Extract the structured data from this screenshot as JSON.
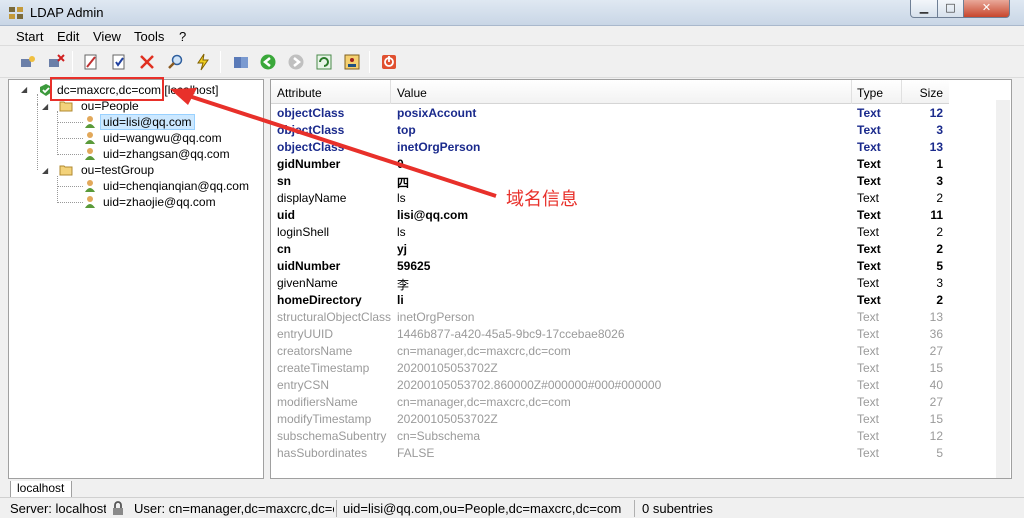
{
  "window": {
    "title": "LDAP Admin",
    "min": "▁",
    "max": "□",
    "close": "✕"
  },
  "menu": [
    "Start",
    "Edit",
    "View",
    "Tools",
    "?"
  ],
  "tree": {
    "root": "dc=maxcrc,dc=com [localhost]",
    "ou_people": "ou=People",
    "people": [
      "uid=lisi@qq.com",
      "uid=wangwu@qq.com",
      "uid=zhangsan@qq.com"
    ],
    "ou_testgroup": "ou=testGroup",
    "testgroup": [
      "uid=chenqianqian@qq.com",
      "uid=zhaojie@qq.com"
    ]
  },
  "table": {
    "headers": {
      "attribute": "Attribute",
      "value": "Value",
      "type": "Type",
      "size": "Size"
    },
    "rows": [
      {
        "attr": "objectClass",
        "value": "posixAccount",
        "type": "Text",
        "size": "12",
        "style": "obj"
      },
      {
        "attr": "objectClass",
        "value": "top",
        "type": "Text",
        "size": "3",
        "style": "obj"
      },
      {
        "attr": "objectClass",
        "value": "inetOrgPerson",
        "type": "Text",
        "size": "13",
        "style": "obj"
      },
      {
        "attr": "gidNumber",
        "value": "0",
        "type": "Text",
        "size": "1",
        "style": "bold"
      },
      {
        "attr": "sn",
        "value": "四",
        "type": "Text",
        "size": "3",
        "style": "bold"
      },
      {
        "attr": "displayName",
        "value": "ls",
        "type": "Text",
        "size": "2",
        "style": "normal"
      },
      {
        "attr": "uid",
        "value": "lisi@qq.com",
        "type": "Text",
        "size": "11",
        "style": "bold"
      },
      {
        "attr": "loginShell",
        "value": "ls",
        "type": "Text",
        "size": "2",
        "style": "normal"
      },
      {
        "attr": "cn",
        "value": "yj",
        "type": "Text",
        "size": "2",
        "style": "bold"
      },
      {
        "attr": "uidNumber",
        "value": "59625",
        "type": "Text",
        "size": "5",
        "style": "bold"
      },
      {
        "attr": "givenName",
        "value": "李",
        "type": "Text",
        "size": "3",
        "style": "normal"
      },
      {
        "attr": "homeDirectory",
        "value": "li",
        "type": "Text",
        "size": "2",
        "style": "bold"
      },
      {
        "attr": "structuralObjectClass",
        "value": "inetOrgPerson",
        "type": "Text",
        "size": "13",
        "style": "op"
      },
      {
        "attr": "entryUUID",
        "value": "1446b877-a420-45a5-9bc9-17ccebae8026",
        "type": "Text",
        "size": "36",
        "style": "op"
      },
      {
        "attr": "creatorsName",
        "value": "cn=manager,dc=maxcrc,dc=com",
        "type": "Text",
        "size": "27",
        "style": "op"
      },
      {
        "attr": "createTimestamp",
        "value": "20200105053702Z",
        "type": "Text",
        "size": "15",
        "style": "op"
      },
      {
        "attr": "entryCSN",
        "value": "20200105053702.860000Z#000000#000#000000",
        "type": "Text",
        "size": "40",
        "style": "op"
      },
      {
        "attr": "modifiersName",
        "value": "cn=manager,dc=maxcrc,dc=com",
        "type": "Text",
        "size": "27",
        "style": "op"
      },
      {
        "attr": "modifyTimestamp",
        "value": "20200105053702Z",
        "type": "Text",
        "size": "15",
        "style": "op"
      },
      {
        "attr": "subschemaSubentry",
        "value": "cn=Subschema",
        "type": "Text",
        "size": "12",
        "style": "op"
      },
      {
        "attr": "hasSubordinates",
        "value": "FALSE",
        "type": "Text",
        "size": "5",
        "style": "op"
      }
    ]
  },
  "tab": "localhost",
  "status": {
    "server": "Server: localhost",
    "user": "User: cn=manager,dc=maxcrc,dc=com",
    "dn": "uid=lisi@qq.com,ou=People,dc=maxcrc,dc=com",
    "subentries": "0 subentries"
  },
  "annotation": "域名信息",
  "colors": {
    "annotation": "#e8302a",
    "objectclass": "#1a2a8c",
    "operational": "#9a9a9a"
  }
}
